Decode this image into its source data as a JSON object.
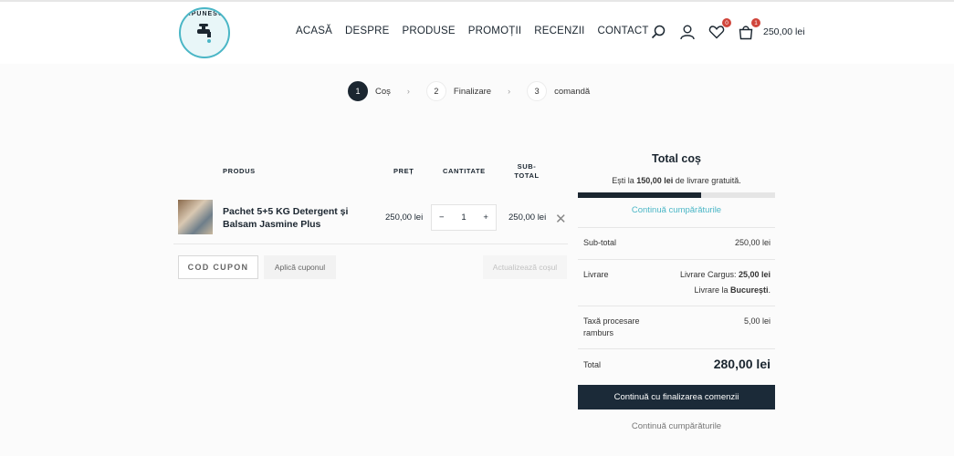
{
  "header": {
    "logo_text": "SĂPUNESCU",
    "nav": [
      "ACASĂ",
      "DESPRE",
      "PRODUSE",
      "PROMOȚII",
      "RECENZII",
      "CONTACT"
    ],
    "wishlist_count": "0",
    "cart_count": "1",
    "cart_total": "250,00 lei"
  },
  "steps": [
    {
      "num": "1",
      "label": "Coș"
    },
    {
      "num": "2",
      "label": "Finalizare"
    },
    {
      "num": "3",
      "label": "comandă"
    }
  ],
  "table": {
    "headers": {
      "product": "PRODUS",
      "price": "PREȚ",
      "qty": "CANTITATE",
      "subtotal_1": "SUB-",
      "subtotal_2": "TOTAL"
    },
    "item": {
      "name": "Pachet 5+5 KG Detergent și Balsam Jasmine Plus",
      "price": "250,00 lei",
      "quantity": "1",
      "subtotal": "250,00 lei"
    }
  },
  "actions": {
    "coupon_placeholder": "COD CUPON",
    "apply_coupon": "Aplică cuponul",
    "update_cart": "Actualizează coșul"
  },
  "totals": {
    "title": "Total coș",
    "free_pre": "Ești la ",
    "free_amount": "150,00 lei",
    "free_post": " de livrare gratuită.",
    "progress_fraction": 0.625,
    "continue_shopping": "Continuă cumpărăturile",
    "subtotal_label": "Sub-total",
    "subtotal_value": "250,00 lei",
    "shipping_label": "Livrare",
    "shipping_method": "Livrare Cargus: ",
    "shipping_price": "25,00 lei",
    "shipping_to": "Livrare la ",
    "shipping_city": "București",
    "fee_label": "Taxă procesare ramburs",
    "fee_value": "5,00 lei",
    "total_label": "Total",
    "total_value": "280,00 lei",
    "checkout_button": "Continuă cu finalizarea comenzii",
    "continue_bottom": "Continuă cumpărăturile"
  },
  "colors": {
    "primary": "#1b2630",
    "accent": "#4ab6c6",
    "badge": "#d0453b"
  }
}
